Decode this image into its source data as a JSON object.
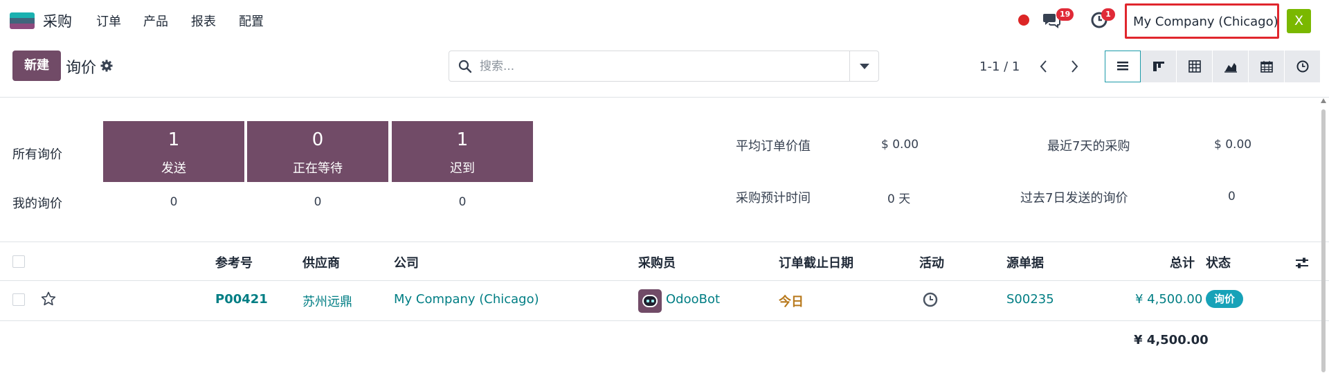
{
  "app": {
    "name": "采购"
  },
  "nav": {
    "items": [
      "订单",
      "产品",
      "报表",
      "配置"
    ]
  },
  "systray": {
    "messages_count": "19",
    "activities_count": "1",
    "company": "My Company (Chicago)",
    "user_initial": "X",
    "colors": {
      "record": "#dc2626",
      "badge": "#e02a37",
      "avatar": "#7ab800"
    }
  },
  "control": {
    "new_label": "新建",
    "breadcrumb": "询价",
    "search_placeholder": "搜索...",
    "pager": "1-1 / 1",
    "views": [
      "list-icon",
      "kanban-icon",
      "pivot-icon",
      "graph-icon",
      "calendar-icon",
      "activity-icon"
    ]
  },
  "dashboard": {
    "all_rfqs": "所有询价",
    "my_rfqs": "我的询价",
    "tiles": [
      {
        "num": "1",
        "label": "发送",
        "mine": "0"
      },
      {
        "num": "0",
        "label": "正在等待",
        "mine": "0"
      },
      {
        "num": "1",
        "label": "迟到",
        "mine": "0"
      }
    ],
    "stats": {
      "avg_order_label": "平均订单价值",
      "avg_order_value": "$ 0.00",
      "last7_label": "最近7天的采购",
      "last7_value": "$ 0.00",
      "lead_time_label": "采购预计时间",
      "lead_time_value": "0 天",
      "sent7_label": "过去7日发送的询价",
      "sent7_value": "0"
    },
    "tile_color": "#714b67"
  },
  "table": {
    "headers": {
      "ref": "参考号",
      "vendor": "供应商",
      "company": "公司",
      "buyer": "采购员",
      "deadline": "订单截止日期",
      "activity": "活动",
      "source": "源单据",
      "total": "总计",
      "status": "状态"
    },
    "rows": [
      {
        "ref": "P00421",
        "vendor": "苏州远鼎",
        "company": "My Company (Chicago)",
        "buyer": "OdooBot",
        "deadline": "今日",
        "source": "S00235",
        "total": "¥ 4,500.00",
        "status": "询价"
      }
    ],
    "grand_total": "¥ 4,500.00"
  }
}
